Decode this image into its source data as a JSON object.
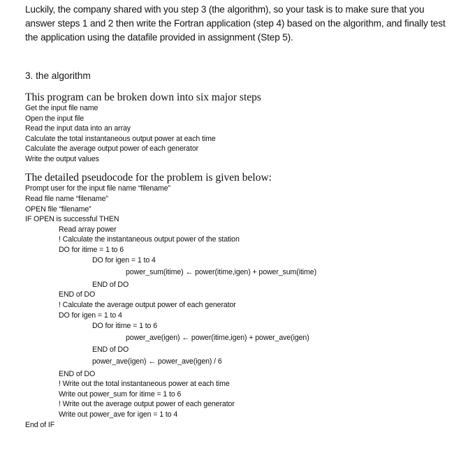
{
  "intro": {
    "lines": [
      "Luckily, the company shared with you step 3 (the algorithm), so your task is to make sure that you",
      "answer steps 1 and 2 then write the Fortran application (step 4) based on the algorithm, and finally test",
      "the application using the datafile provided in assignment (Step 5)."
    ]
  },
  "section": {
    "title": "3. the algorithm"
  },
  "major_steps": {
    "heading": "This program can be broken down into six major steps",
    "items": [
      "Get the input file name",
      "Open the input file",
      "Read the input data into an array",
      "Calculate the total instantaneous output power at each time",
      "Calculate the average output power of each generator",
      "Write the output values"
    ]
  },
  "pseudocode": {
    "heading": "The detailed pseudocode for the problem is given below:",
    "arrow": "←",
    "lines": [
      {
        "indent": 0,
        "text": "Prompt user for the input file name “filename”"
      },
      {
        "indent": 0,
        "text": "Read file name “filename”"
      },
      {
        "indent": 0,
        "text": "OPEN file “filename”"
      },
      {
        "indent": 0,
        "text": "IF OPEN is successful THEN"
      },
      {
        "indent": 1,
        "text": "Read array power"
      },
      {
        "indent": 1,
        "text": "! Calculate the instantaneous output power of the station"
      },
      {
        "indent": 1,
        "text": "DO for itime = 1 to 6"
      },
      {
        "indent": 2,
        "text": "DO for igen = 1 to 4"
      },
      {
        "indent": 3,
        "lhs": "power_sum(itime)",
        "rhs": "power(itime,igen) + power_sum(itime)"
      },
      {
        "indent": 2,
        "text": "END of DO"
      },
      {
        "indent": 1,
        "text": "END of DO"
      },
      {
        "indent": 1,
        "text": "! Calculate the average output power of each generator"
      },
      {
        "indent": 1,
        "text": "DO for igen = 1 to 4"
      },
      {
        "indent": 2,
        "text": "DO for itime = 1 to 6"
      },
      {
        "indent": 3,
        "lhs": "power_ave(igen)",
        "rhs": "power(itime,igen) + power_ave(igen)"
      },
      {
        "indent": 2,
        "text": "END of DO"
      },
      {
        "indent": 2,
        "lhs": "power_ave(igen)",
        "rhs": "power_ave(igen) / 6"
      },
      {
        "indent": 1,
        "text": "END of DO"
      },
      {
        "indent": 1,
        "text": "! Write out the total instantaneous power at each time"
      },
      {
        "indent": 1,
        "text": "Write out power_sum for itime = 1 to 6"
      },
      {
        "indent": 1,
        "text": "! Write out the average output power of each generator"
      },
      {
        "indent": 1,
        "text": "Write out power_ave for igen = 1 to 4"
      },
      {
        "indent": 0,
        "text": "End of IF"
      }
    ]
  }
}
